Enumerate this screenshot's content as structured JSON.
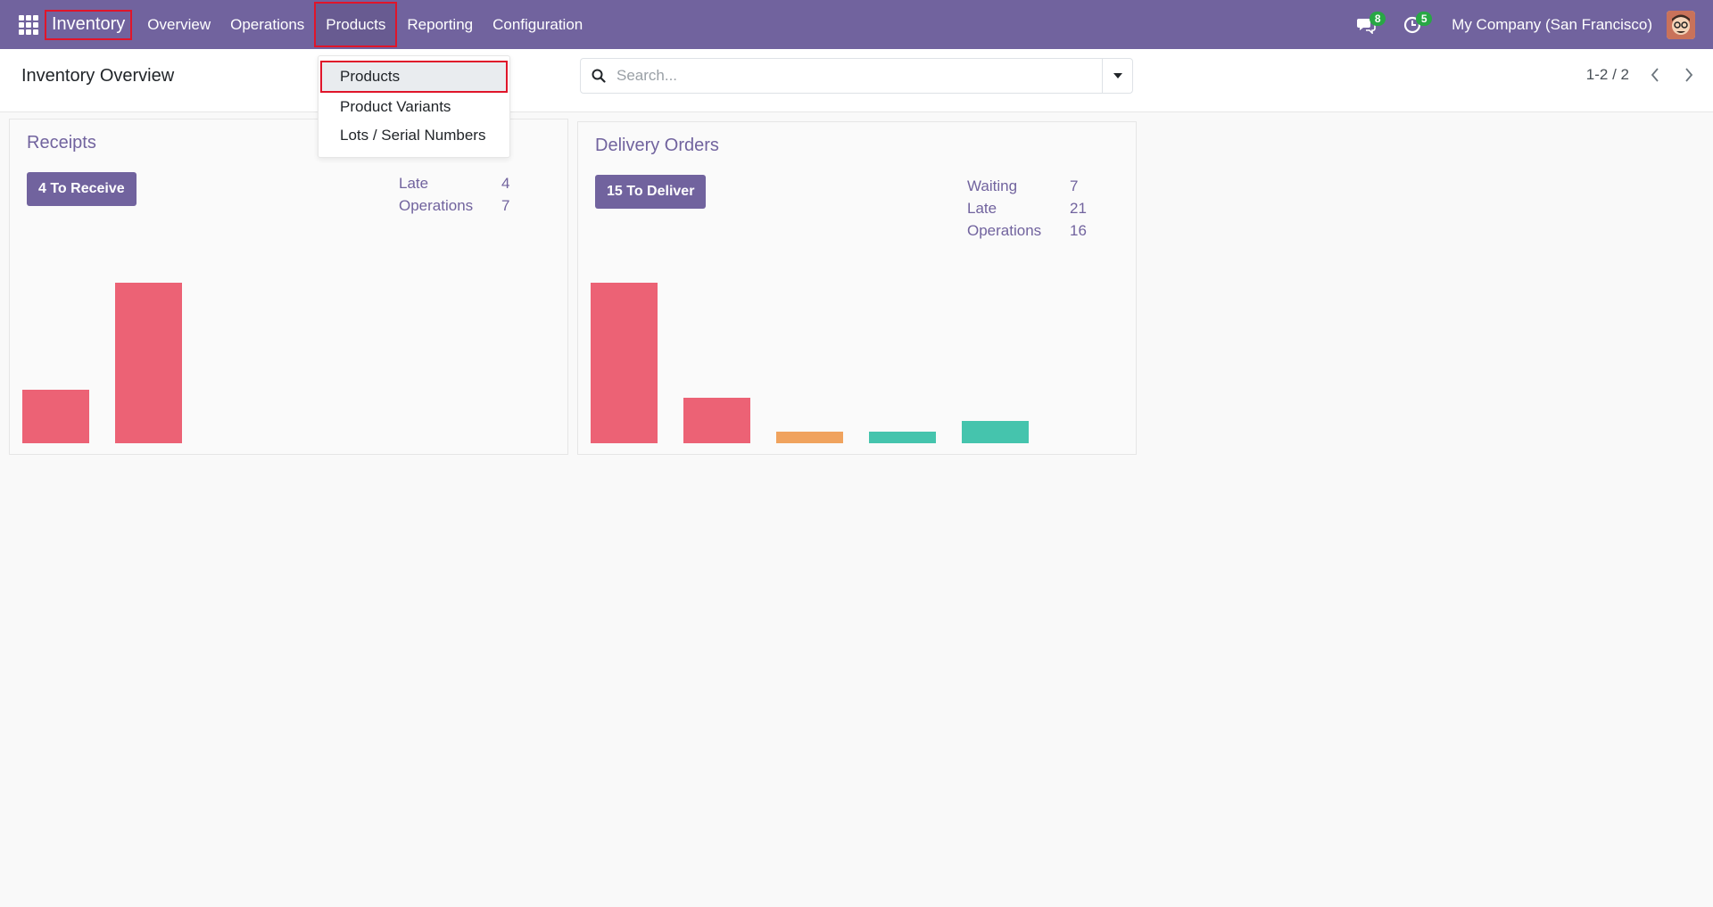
{
  "navbar": {
    "app_name": "Inventory",
    "menu": [
      {
        "label": "Overview"
      },
      {
        "label": "Operations"
      },
      {
        "label": "Products"
      },
      {
        "label": "Reporting"
      },
      {
        "label": "Configuration"
      }
    ],
    "messages_count": "8",
    "activities_count": "5",
    "company": "My Company (San Francisco)"
  },
  "products_menu": {
    "items": [
      {
        "label": "Products"
      },
      {
        "label": "Product Variants"
      },
      {
        "label": "Lots / Serial Numbers"
      }
    ]
  },
  "control_panel": {
    "title": "Inventory Overview",
    "search_placeholder": "Search...",
    "pager": "1-2 / 2"
  },
  "cards": {
    "receipts": {
      "title": "Receipts",
      "button": "4 To Receive",
      "stats": [
        {
          "label": "Late",
          "value": "4"
        },
        {
          "label": "Operations",
          "value": "7"
        }
      ]
    },
    "delivery": {
      "title": "Delivery Orders",
      "button": "15 To Deliver",
      "stats": [
        {
          "label": "Waiting",
          "value": "7"
        },
        {
          "label": "Late",
          "value": "21"
        },
        {
          "label": "Operations",
          "value": "16"
        }
      ]
    }
  },
  "colors": {
    "navbar": "#71639e",
    "late_bar": "#ec6275",
    "future_bar_orange": "#f0a35e",
    "future_bar_teal": "#45c4ad"
  },
  "chart_data": [
    {
      "type": "bar",
      "ylim": [
        0,
        3
      ],
      "values": [
        1,
        3
      ],
      "colors": [
        "#ec6275",
        "#ec6275"
      ]
    },
    {
      "type": "bar",
      "ylim": [
        0,
        11
      ],
      "values": [
        11,
        3.1,
        0.8,
        0.8,
        1.5
      ],
      "colors": [
        "#ec6275",
        "#ec6275",
        "#f0a35e",
        "#45c4ad",
        "#45c4ad"
      ]
    }
  ]
}
